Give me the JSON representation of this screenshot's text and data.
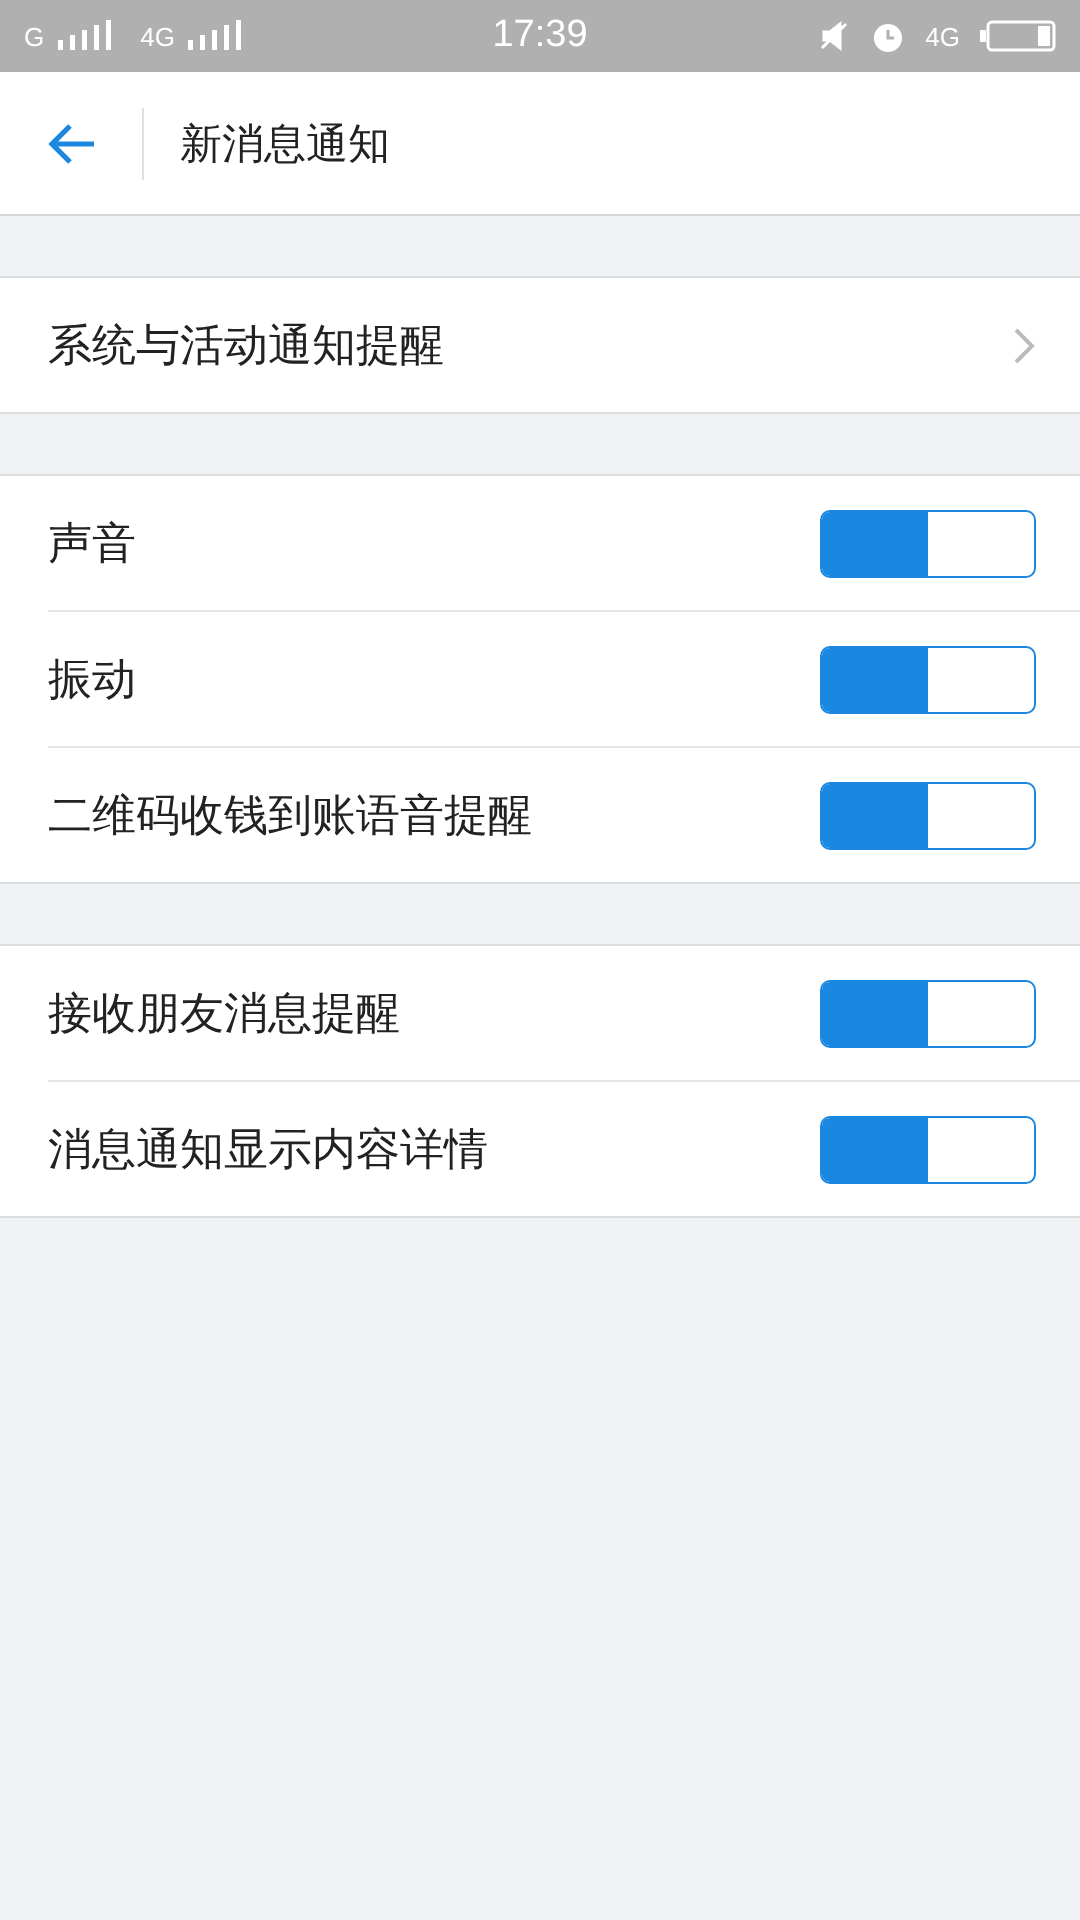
{
  "status_bar": {
    "sim1": "G",
    "sim2": "4G",
    "time": "17:39",
    "network": "4G"
  },
  "header": {
    "title": "新消息通知"
  },
  "groups": [
    {
      "rows": [
        {
          "kind": "link",
          "label": "系统与活动通知提醒"
        }
      ]
    },
    {
      "rows": [
        {
          "kind": "toggle",
          "label": "声音",
          "on": true
        },
        {
          "kind": "toggle",
          "label": "振动",
          "on": true
        },
        {
          "kind": "toggle",
          "label": "二维码收钱到账语音提醒",
          "on": true
        }
      ]
    },
    {
      "rows": [
        {
          "kind": "toggle",
          "label": "接收朋友消息提醒",
          "on": true
        },
        {
          "kind": "toggle",
          "label": "消息通知显示内容详情",
          "on": true
        }
      ]
    }
  ]
}
